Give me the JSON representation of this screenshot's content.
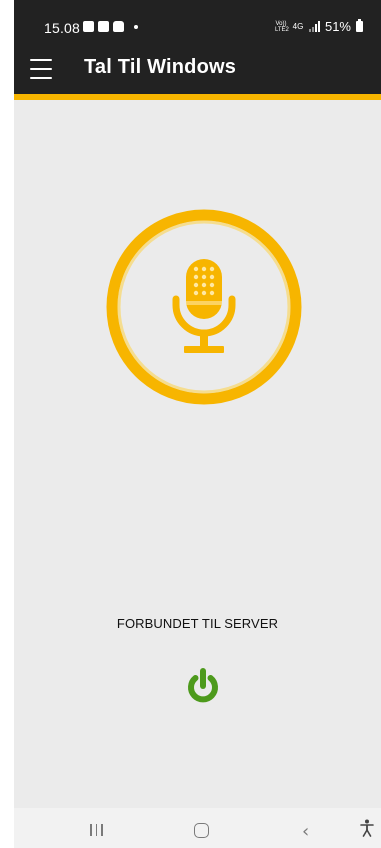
{
  "status_bar": {
    "time": "15.08",
    "volte_label": "Vo))\nLTE2",
    "network_label": "4G",
    "battery_percent": "51%"
  },
  "app_bar": {
    "title": "Tal Til Windows",
    "menu_icon": "hamburger-menu-icon"
  },
  "main": {
    "mic_icon": "microphone-icon",
    "connection_status": "FORBUNDET TIL SERVER",
    "power_icon": "power-icon"
  },
  "nav_bar": {
    "recents_icon": "recents-icon",
    "home_icon": "home-icon",
    "back_icon": "back-icon",
    "accessibility_icon": "accessibility-icon"
  },
  "colors": {
    "accent": "#f7b500",
    "app_bar": "#222222",
    "background": "#ebebeb",
    "power_green": "#4d9a1c"
  }
}
